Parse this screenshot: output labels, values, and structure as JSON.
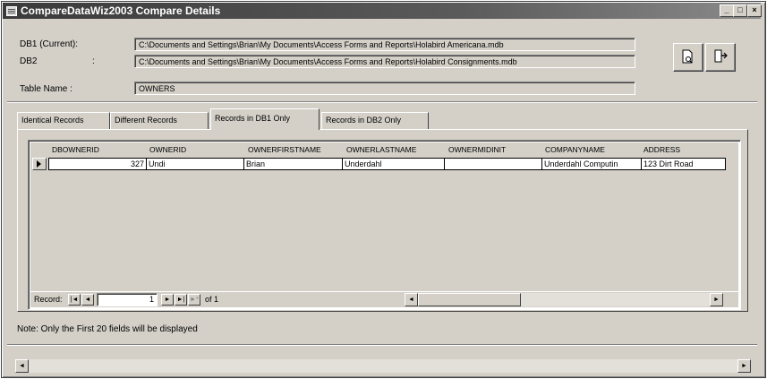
{
  "window": {
    "title": "CompareDataWiz2003 Compare Details",
    "controls": [
      "_",
      "□",
      "×"
    ]
  },
  "db": {
    "db1_label": "DB1 (Current):",
    "db1_path": "C:\\Documents and Settings\\Brian\\My Documents\\Access Forms and Reports\\Holabird Americana.mdb",
    "db2_label": "DB2",
    "db2_colon": ":",
    "db2_path": "C:\\Documents and Settings\\Brian\\My Documents\\Access Forms and Reports\\Holabird Consignments.mdb"
  },
  "table": {
    "label": "Table Name :",
    "value": "OWNERS"
  },
  "buttons": {
    "preview_icon": "print-preview-icon",
    "exit_icon": "exit-door-icon"
  },
  "tabs": [
    {
      "label": "Identical Records"
    },
    {
      "label": "Different Records"
    },
    {
      "label": "Records in DB1 Only"
    },
    {
      "label": "Records in DB2 Only"
    }
  ],
  "grid": {
    "columns": [
      "DBOWNERID",
      "OWNERID",
      "OWNERFIRSTNAME",
      "OWNERLASTNAME",
      "OWNERMIDINIT",
      "COMPANYNAME",
      "ADDRESS"
    ],
    "row": [
      "327",
      "Undi",
      "Brian",
      "Underdahl",
      "",
      "Underdahl Computin",
      "123 Dirt Road"
    ]
  },
  "navigator": {
    "label": "Record:",
    "current": "1",
    "of_text": "of 1",
    "first": "|◄",
    "prev": "◄",
    "next": "►",
    "last": "►|",
    "new": "►*"
  },
  "note": "Note: Only the First 20 fields will be displayed"
}
